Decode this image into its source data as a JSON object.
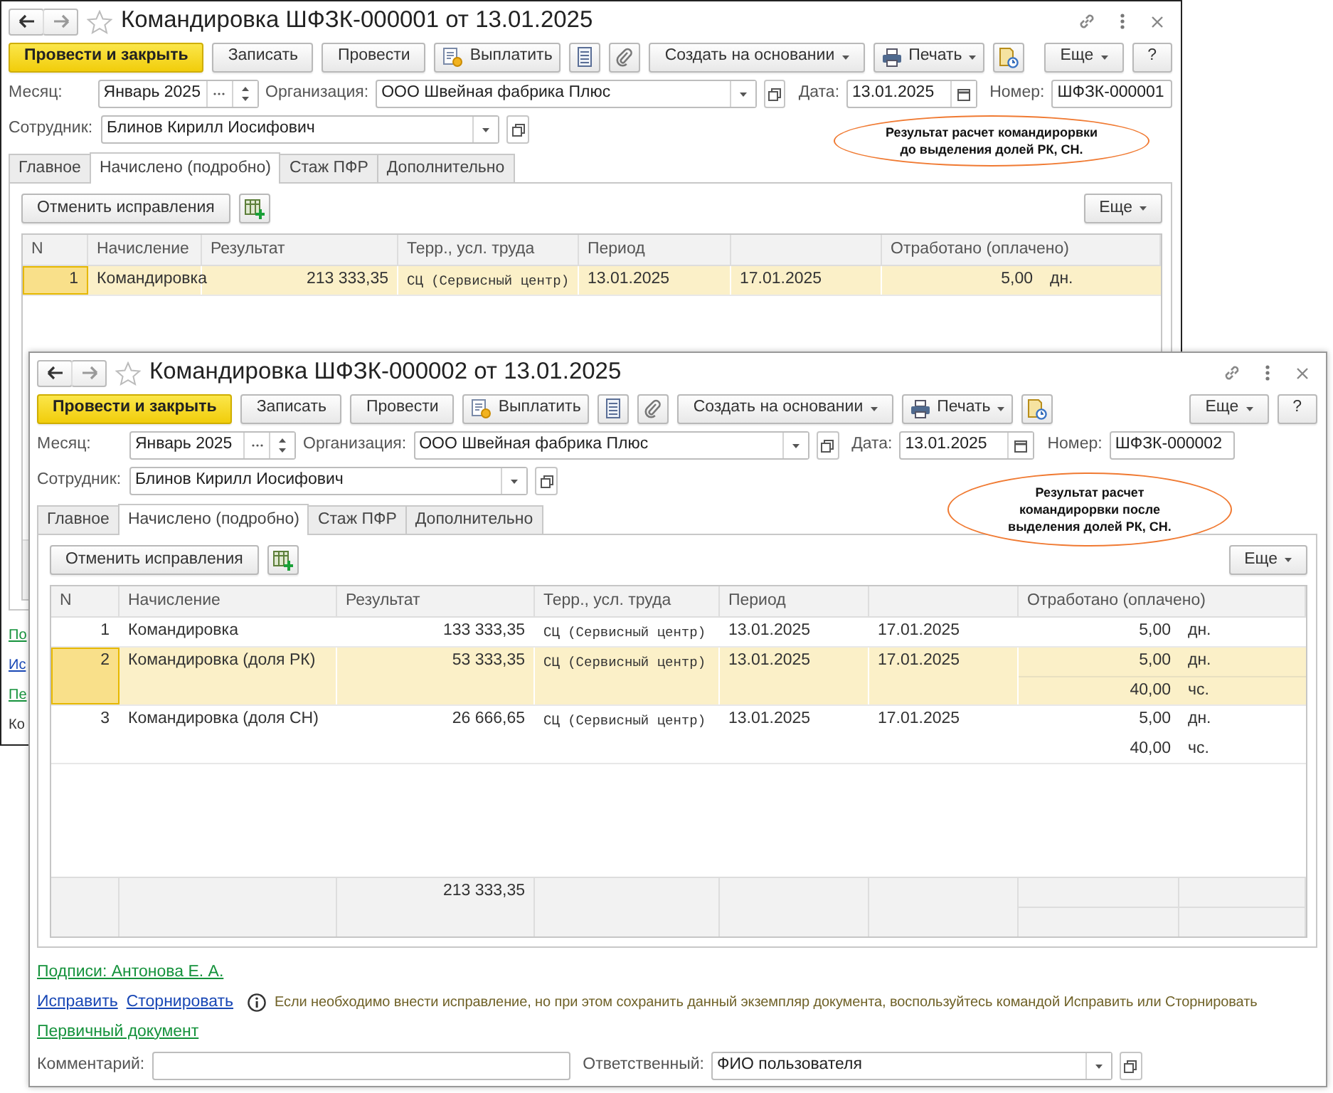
{
  "windows": [
    {
      "title": "Командировка ШФЗК-000001 от 13.01.2025",
      "toolbar": [
        {
          "label": "Провести и закрыть",
          "kind": "primary"
        },
        {
          "label": "Записать",
          "kind": "plain"
        },
        {
          "label": "Провести",
          "kind": "plain"
        },
        {
          "label": "Выплатить",
          "kind": "pay"
        },
        {
          "kind": "list"
        },
        {
          "kind": "clip"
        },
        {
          "label": "Создать на основании",
          "kind": "menu"
        },
        {
          "label": "Печать",
          "kind": "print"
        },
        {
          "kind": "report"
        },
        {
          "label": "Еще",
          "kind": "more"
        },
        {
          "label": "?",
          "kind": "plain"
        }
      ],
      "fields": {
        "month": {
          "label": "Месяц:",
          "value": "Январь 2025"
        },
        "organization": {
          "label": "Организация:",
          "value": "ООО Швейная фабрика Плюс"
        },
        "date": {
          "label": "Дата:",
          "value": "13.01.2025"
        },
        "number": {
          "label": "Номер:",
          "value": "ШФЗК-000001"
        },
        "employee": {
          "label": "Сотрудник:",
          "value": "Блинов Кирилл Иосифович"
        }
      },
      "callout": [
        "Результат расчет командирорвки",
        "до выделения долей РК, СН."
      ],
      "tabs": [
        {
          "label": "Главное",
          "selected": false
        },
        {
          "label": "Начислено (подробно)",
          "selected": true
        },
        {
          "label": "Стаж ПФР",
          "selected": false
        },
        {
          "label": "Дополнительно",
          "selected": false
        }
      ],
      "table_toolbar": {
        "cancel": "Отменить исправления",
        "more": "Еще"
      },
      "table": {
        "columns": [
          "N",
          "Начисление",
          "Результат",
          "Терр., усл. труда",
          "Период",
          "Отработано (оплачено)"
        ],
        "rows": [
          {
            "n": "1",
            "accrual": "Командировка",
            "result": "213 333,35",
            "territory": "СЦ (Сервисный центр)",
            "period_from": "13.01.2025",
            "period_to": "17.01.2025",
            "worked": [
              {
                "value": "5,00",
                "unit": "дн."
              }
            ],
            "selected": true
          }
        ]
      },
      "footer_cut": [
        {
          "text": "По",
          "kind": "link"
        },
        {
          "text": "Ис",
          "kind": "action"
        },
        {
          "text": "Пе",
          "kind": "link"
        },
        {
          "text": "Ко",
          "kind": "label"
        }
      ]
    },
    {
      "title": "Командировка ШФЗК-000002 от 13.01.2025",
      "toolbar": [
        {
          "label": "Провести и закрыть",
          "kind": "primary"
        },
        {
          "label": "Записать",
          "kind": "plain"
        },
        {
          "label": "Провести",
          "kind": "plain"
        },
        {
          "label": "Выплатить",
          "kind": "pay"
        },
        {
          "kind": "list"
        },
        {
          "kind": "clip"
        },
        {
          "label": "Создать на основании",
          "kind": "menu"
        },
        {
          "label": "Печать",
          "kind": "print"
        },
        {
          "kind": "report"
        },
        {
          "label": "Еще",
          "kind": "more"
        },
        {
          "label": "?",
          "kind": "plain"
        }
      ],
      "fields": {
        "month": {
          "label": "Месяц:",
          "value": "Январь 2025"
        },
        "organization": {
          "label": "Организация:",
          "value": "ООО Швейная фабрика Плюс"
        },
        "date": {
          "label": "Дата:",
          "value": "13.01.2025"
        },
        "number": {
          "label": "Номер:",
          "value": "ШФЗК-000002"
        },
        "employee": {
          "label": "Сотрудник:",
          "value": "Блинов Кирилл Иосифович"
        }
      },
      "callout": [
        "Результат расчет",
        "командирорвки после",
        "выделения долей РК, СН."
      ],
      "tabs": [
        {
          "label": "Главное",
          "selected": false
        },
        {
          "label": "Начислено (подробно)",
          "selected": true
        },
        {
          "label": "Стаж ПФР",
          "selected": false
        },
        {
          "label": "Дополнительно",
          "selected": false
        }
      ],
      "table_toolbar": {
        "cancel": "Отменить исправления",
        "more": "Еще"
      },
      "table": {
        "columns": [
          "N",
          "Начисление",
          "Результат",
          "Терр., усл. труда",
          "Период",
          "Отработано (оплачено)"
        ],
        "rows": [
          {
            "n": "1",
            "accrual": "Командировка",
            "result": "133 333,35",
            "territory": "СЦ (Сервисный центр)",
            "period_from": "13.01.2025",
            "period_to": "17.01.2025",
            "worked": [
              {
                "value": "5,00",
                "unit": "дн."
              }
            ],
            "selected": false
          },
          {
            "n": "2",
            "accrual": "Командировка (доля РК)",
            "result": "53 333,35",
            "territory": "СЦ (Сервисный центр)",
            "period_from": "13.01.2025",
            "period_to": "17.01.2025",
            "worked": [
              {
                "value": "5,00",
                "unit": "дн."
              },
              {
                "value": "40,00",
                "unit": "чс."
              }
            ],
            "selected": true
          },
          {
            "n": "3",
            "accrual": "Командировка (доля СН)",
            "result": "26 666,65",
            "territory": "СЦ (Сервисный центр)",
            "period_from": "13.01.2025",
            "period_to": "17.01.2025",
            "worked": [
              {
                "value": "5,00",
                "unit": "дн."
              },
              {
                "value": "40,00",
                "unit": "чс."
              }
            ],
            "selected": false
          }
        ],
        "totals": {
          "result": "213 333,35"
        }
      },
      "footer": {
        "signatures": "Подписи: Антонова Е. А.",
        "actions": [
          "Исправить",
          "Сторнировать"
        ],
        "notice": "Если необходимо внести исправление, но при этом сохранить данный экземпляр документа, воспользуйтесь командой Исправить или Сторнировать",
        "primary_document": "Первичный документ",
        "comment": {
          "label": "Комментарий:"
        },
        "responsible": {
          "label": "Ответственный:",
          "value": "ФИО пользователя"
        }
      }
    }
  ]
}
